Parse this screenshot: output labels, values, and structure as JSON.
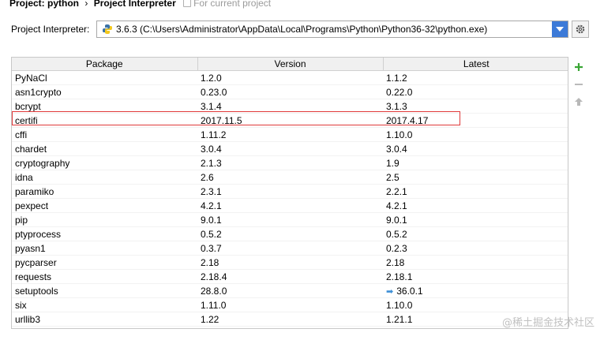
{
  "breadcrumb": {
    "project": "Project: python",
    "separator": "›",
    "page": "Project Interpreter",
    "hint": "For current project"
  },
  "interpreter": {
    "label": "Project Interpreter:",
    "value": "3.6.3 (C:\\Users\\Administrator\\AppData\\Local\\Programs\\Python\\Python36-32\\python.exe)"
  },
  "table": {
    "headers": [
      "Package",
      "Version",
      "Latest"
    ],
    "rows": [
      {
        "package": "PyNaCl",
        "version": "1.2.0",
        "latest": "1.1.2",
        "upgrade": false
      },
      {
        "package": "asn1crypto",
        "version": "0.23.0",
        "latest": "0.22.0",
        "upgrade": false
      },
      {
        "package": "bcrypt",
        "version": "3.1.4",
        "latest": "3.1.3",
        "upgrade": false
      },
      {
        "package": "certifi",
        "version": "2017.11.5",
        "latest": "2017.4.17",
        "upgrade": false,
        "highlighted": true
      },
      {
        "package": "cffi",
        "version": "1.11.2",
        "latest": "1.10.0",
        "upgrade": false
      },
      {
        "package": "chardet",
        "version": "3.0.4",
        "latest": "3.0.4",
        "upgrade": false
      },
      {
        "package": "cryptography",
        "version": "2.1.3",
        "latest": "1.9",
        "upgrade": false
      },
      {
        "package": "idna",
        "version": "2.6",
        "latest": "2.5",
        "upgrade": false
      },
      {
        "package": "paramiko",
        "version": "2.3.1",
        "latest": "2.2.1",
        "upgrade": false
      },
      {
        "package": "pexpect",
        "version": "4.2.1",
        "latest": "4.2.1",
        "upgrade": false
      },
      {
        "package": "pip",
        "version": "9.0.1",
        "latest": "9.0.1",
        "upgrade": false
      },
      {
        "package": "ptyprocess",
        "version": "0.5.2",
        "latest": "0.5.2",
        "upgrade": false
      },
      {
        "package": "pyasn1",
        "version": "0.3.7",
        "latest": "0.2.3",
        "upgrade": false
      },
      {
        "package": "pycparser",
        "version": "2.18",
        "latest": "2.18",
        "upgrade": false
      },
      {
        "package": "requests",
        "version": "2.18.4",
        "latest": "2.18.1",
        "upgrade": false
      },
      {
        "package": "setuptools",
        "version": "28.8.0",
        "latest": "36.0.1",
        "upgrade": true
      },
      {
        "package": "six",
        "version": "1.11.0",
        "latest": "1.10.0",
        "upgrade": false
      },
      {
        "package": "urllib3",
        "version": "1.22",
        "latest": "1.21.1",
        "upgrade": false
      }
    ]
  },
  "tools": {
    "add": "+",
    "remove": "−",
    "upgrade": "⇧"
  },
  "icons": {
    "python": "python-icon",
    "dropdown": "chevron-down-icon",
    "gear": "gear-icon",
    "upgrade_arrow": "arrow-right-icon"
  },
  "colors": {
    "highlight_border": "#e0393a",
    "combo_arrow": "#3c7ad8",
    "add_icon": "#3aa635"
  },
  "watermark": "@稀土掘金技术社区"
}
